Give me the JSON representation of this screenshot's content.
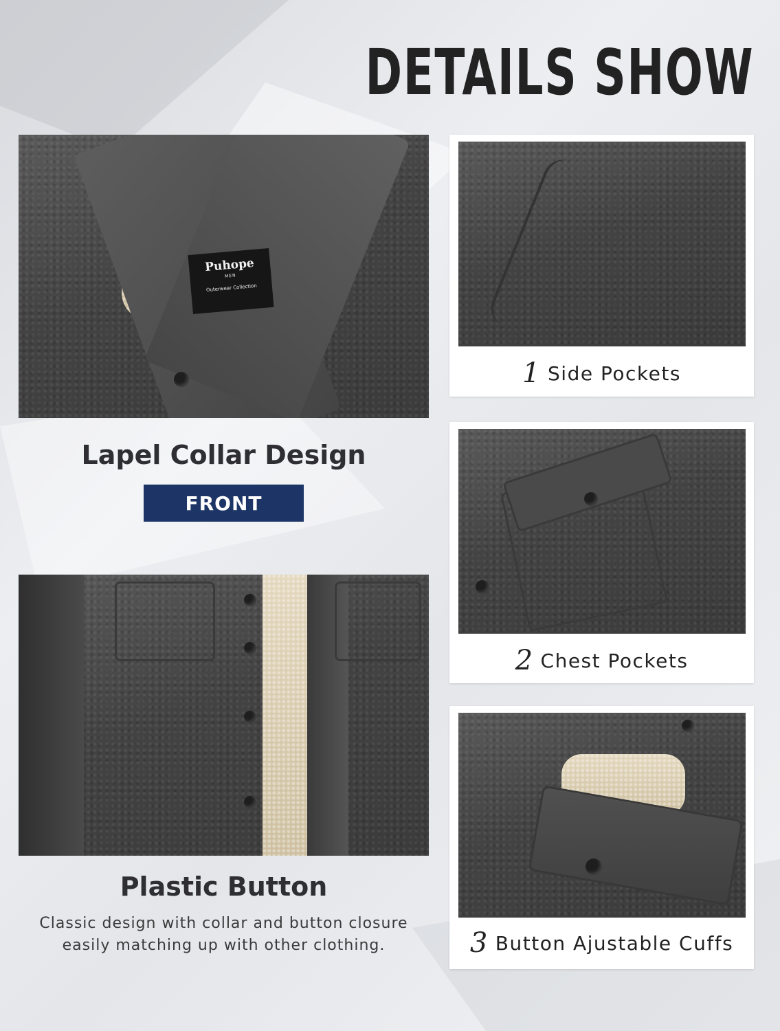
{
  "page": {
    "heading": "DETAILS SHOW"
  },
  "left": {
    "collar_photo": {
      "alt": "Lapel collar close-up",
      "label_brand": "Puhope",
      "label_men": "MEN",
      "label_collection": "Outerwear Collection"
    },
    "collar_title": "Lapel Collar Design",
    "front_tag": "FRONT",
    "button_photo": {
      "alt": "Front button placket with sherpa lining"
    },
    "button_title": "Plastic Button",
    "button_desc_lines": [
      "Classic design with collar and button closure",
      "easily matching up with other clothing."
    ]
  },
  "cards": [
    {
      "num": "1",
      "label": "Side Pockets"
    },
    {
      "num": "2",
      "label": "Chest Pockets"
    },
    {
      "num": "3",
      "label": "Button Ajustable Cuffs"
    }
  ],
  "colors": {
    "tag_bg": "#1d3566",
    "fabric": "#454545",
    "sherpa": "#d8cbb0",
    "text": "#2e2e33"
  }
}
